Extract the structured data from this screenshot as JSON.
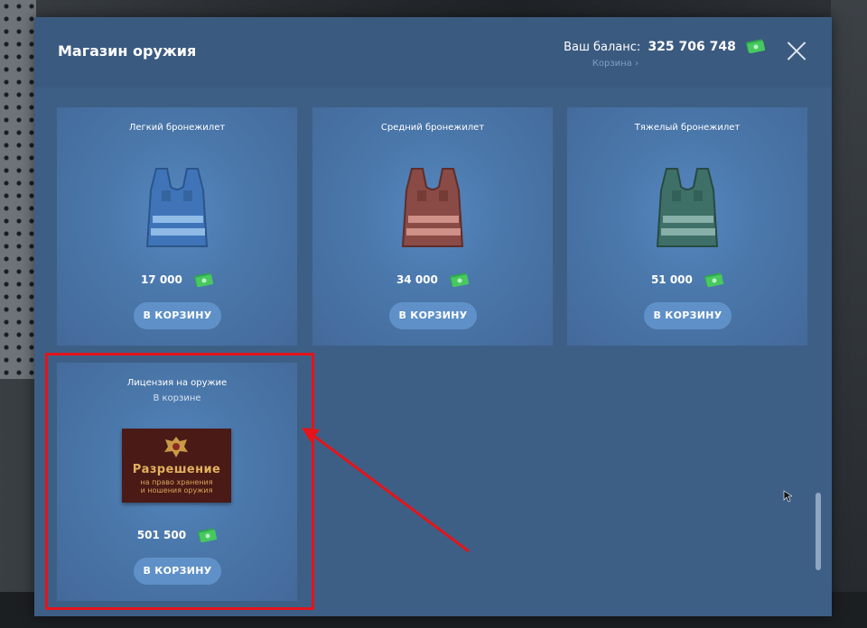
{
  "shop": {
    "title": "Магазин оружия",
    "balance_label": "Ваш баланс:",
    "balance_value": "325 706 748",
    "cart_link": "Корзина ›"
  },
  "items": [
    {
      "title": "Легкий бронежилет",
      "price": "17 000",
      "button": "В КОРЗИНУ",
      "color": "#3f74b9"
    },
    {
      "title": "Средний бронежилет",
      "price": "34 000",
      "button": "В КОРЗИНУ",
      "color": "#8a4a45"
    },
    {
      "title": "Тяжелый бронежилет",
      "price": "51 000",
      "button": "В КОРЗИНУ",
      "color": "#3f7068"
    },
    {
      "title": "Лицензия на оружие",
      "subtitle": "В корзине",
      "price": "501 500",
      "button": "В КОРЗИНУ",
      "permit": {
        "title": "Разрешение",
        "line1": "на право хранения",
        "line2": "и ношения оружия"
      }
    }
  ],
  "colors": {
    "accent": "#5f91c8",
    "highlight": "#e3141a",
    "modal_bg": "#3e5f85"
  },
  "icons": [
    "close-icon",
    "cash-icon",
    "vest-icon",
    "emblem-icon",
    "mouse-cursor-icon"
  ]
}
